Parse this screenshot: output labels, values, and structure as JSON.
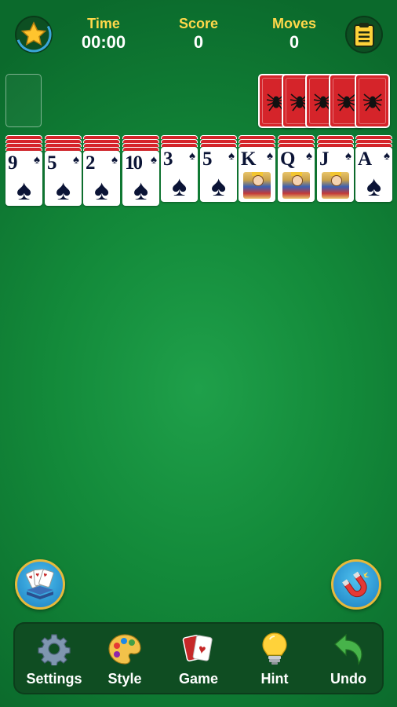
{
  "header": {
    "time_label": "Time",
    "time_value": "00:00",
    "score_label": "Score",
    "score_value": "0",
    "moves_label": "Moves",
    "moves_value": "0"
  },
  "icons": {
    "left_top": "star-icon",
    "right_top": "clipboard-icon",
    "card_back": "spider-icon",
    "left_round": "card-deck-icon",
    "right_round": "magnet-icon"
  },
  "tableau": [
    {
      "rank": "9",
      "suit": "♠",
      "hidden": 4
    },
    {
      "rank": "5",
      "suit": "♠",
      "hidden": 4
    },
    {
      "rank": "2",
      "suit": "♠",
      "hidden": 4
    },
    {
      "rank": "10",
      "suit": "♠",
      "hidden": 4
    },
    {
      "rank": "3",
      "suit": "♠",
      "hidden": 3
    },
    {
      "rank": "5",
      "suit": "♠",
      "hidden": 3
    },
    {
      "rank": "K",
      "suit": "♠",
      "hidden": 3
    },
    {
      "rank": "Q",
      "suit": "♠",
      "hidden": 3
    },
    {
      "rank": "J",
      "suit": "♠",
      "hidden": 3
    },
    {
      "rank": "A",
      "suit": "♠",
      "hidden": 3
    }
  ],
  "stock_piles": 5,
  "toolbar": {
    "settings_label": "Settings",
    "style_label": "Style",
    "game_label": "Game",
    "hint_label": "Hint",
    "undo_label": "Undo"
  },
  "colors": {
    "felt": "#138a3a",
    "card_back": "#d5242a",
    "accent_yellow": "#ffd84a",
    "toolbar_bg": "#0f4d22"
  }
}
